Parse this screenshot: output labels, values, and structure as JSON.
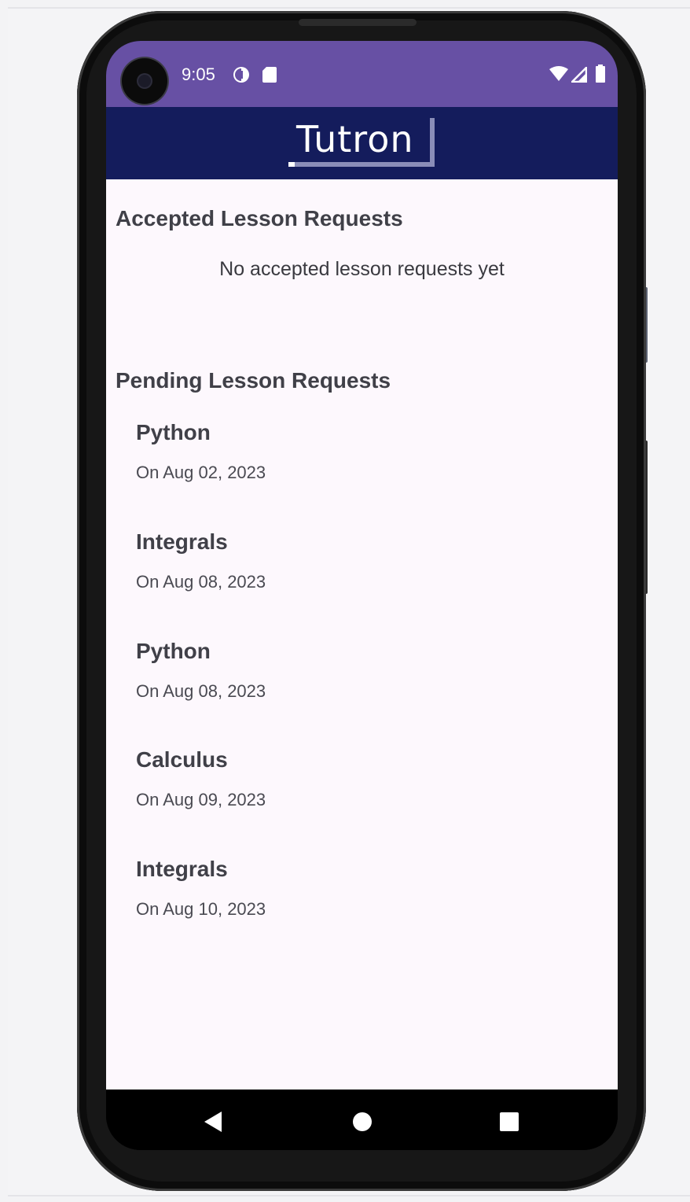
{
  "status_bar": {
    "time": "9:05",
    "icons": [
      "data-saver-icon",
      "sd-card-icon",
      "wifi-icon",
      "signal-icon",
      "battery-icon"
    ]
  },
  "app_bar": {
    "logo_text": "Tutron"
  },
  "accepted": {
    "title": "Accepted Lesson Requests",
    "empty_message": "No accepted lesson requests yet"
  },
  "pending": {
    "title": "Pending Lesson Requests",
    "items": [
      {
        "subject": "Python",
        "date": "On Aug 02, 2023"
      },
      {
        "subject": "Integrals",
        "date": "On Aug 08, 2023"
      },
      {
        "subject": "Python",
        "date": "On Aug 08, 2023"
      },
      {
        "subject": "Calculus",
        "date": "On Aug 09, 2023"
      },
      {
        "subject": "Integrals",
        "date": "On Aug 10, 2023"
      }
    ]
  },
  "nav_bar": {
    "buttons": [
      "back",
      "home",
      "recents"
    ]
  },
  "colors": {
    "status_bar": "#6750a4",
    "app_bar": "#141c5c",
    "content_bg": "#fdf8fd"
  }
}
